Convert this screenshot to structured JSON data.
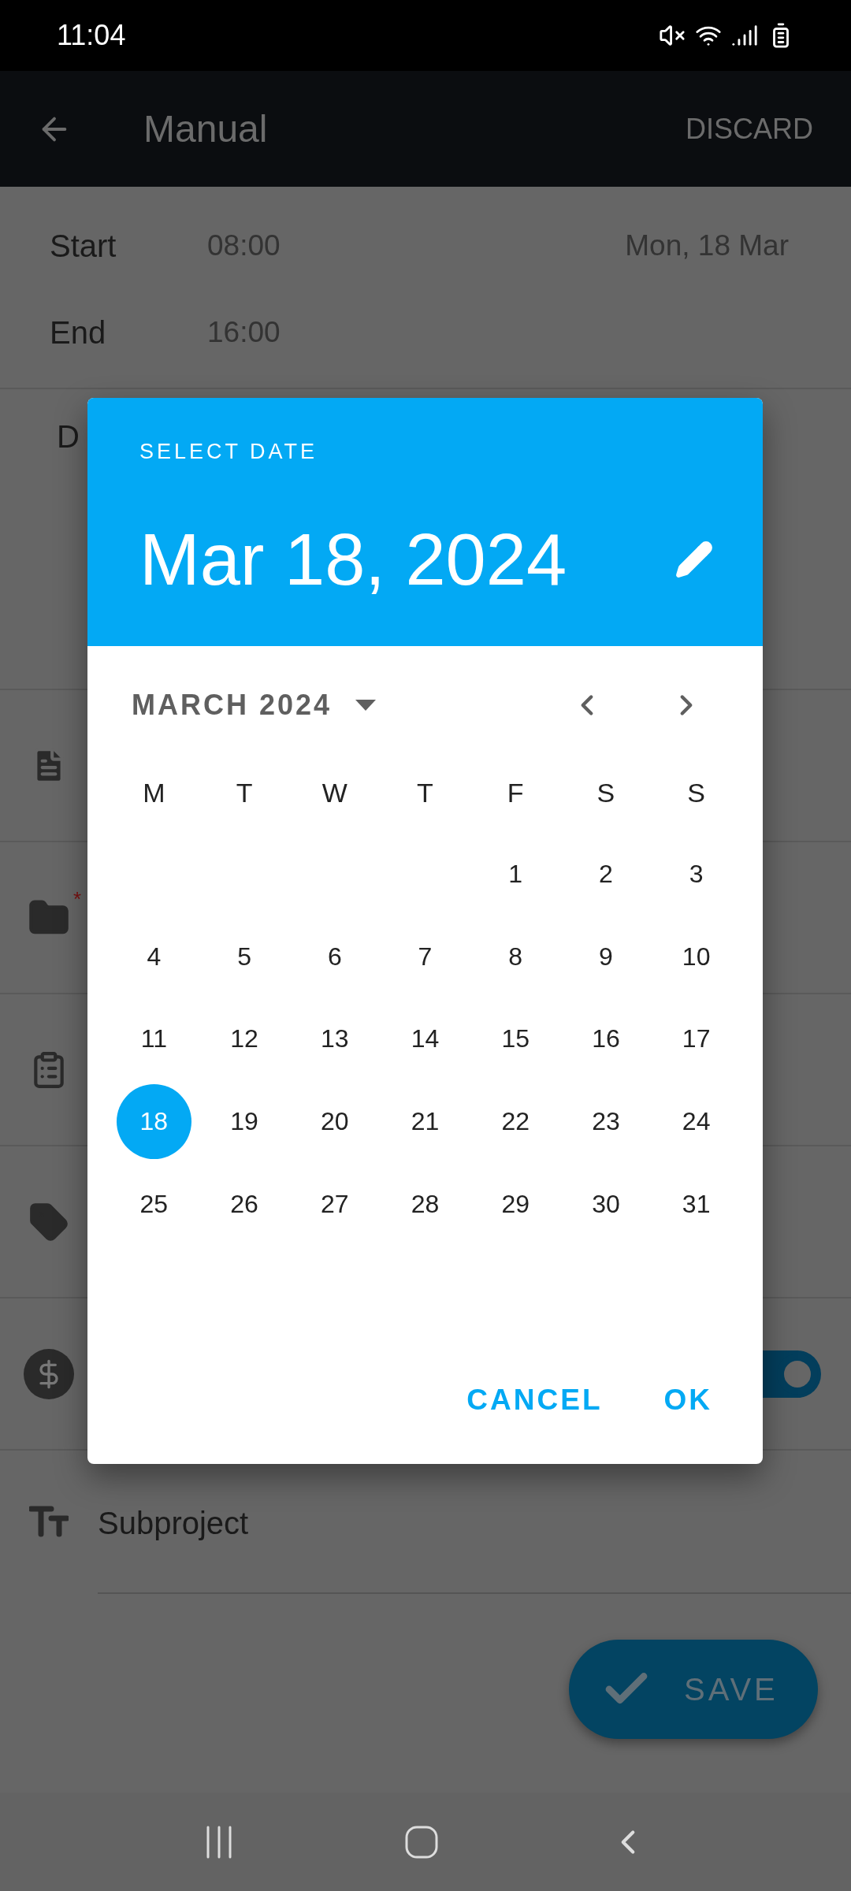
{
  "status_bar": {
    "time": "11:04"
  },
  "app_bar": {
    "title": "Manual",
    "action": "DISCARD"
  },
  "times": [
    {
      "label": "Start",
      "time": "08:00",
      "date": "Mon, 18 Mar"
    },
    {
      "label": "End",
      "time": "16:00"
    }
  ],
  "description_label": "D",
  "required_mark": "*",
  "billable_switch": {
    "on": true
  },
  "subproject": {
    "value": "Subproject"
  },
  "save_button": "SAVE",
  "dialog": {
    "heading": "SELECT DATE",
    "date": "Mar 18, 2024",
    "month": "MARCH 2024",
    "weekdays": [
      "M",
      "T",
      "W",
      "T",
      "F",
      "S",
      "S"
    ],
    "weeks": [
      [
        {
          "kind": "blank"
        },
        {
          "kind": "blank"
        },
        {
          "kind": "blank"
        },
        {
          "kind": "blank"
        },
        {
          "kind": "day",
          "day": "1",
          "selected": false
        },
        {
          "kind": "day",
          "day": "2",
          "selected": false
        },
        {
          "kind": "day",
          "day": "3",
          "selected": false
        }
      ],
      [
        {
          "day": "4",
          "selected": false
        },
        {
          "day": "5",
          "selected": false
        },
        {
          "day": "6",
          "selected": false
        },
        {
          "day": "7",
          "selected": false
        },
        {
          "day": "8",
          "selected": false
        },
        {
          "day": "9",
          "selected": false
        },
        {
          "day": "10",
          "selected": false
        }
      ],
      [
        {
          "day": "11",
          "selected": false
        },
        {
          "day": "12",
          "selected": false
        },
        {
          "day": "13",
          "selected": false
        },
        {
          "day": "14",
          "selected": false
        },
        {
          "day": "15",
          "selected": false
        },
        {
          "day": "16",
          "selected": false
        },
        {
          "day": "17",
          "selected": false
        }
      ],
      [
        {
          "day": "18",
          "selected": true
        },
        {
          "day": "19",
          "selected": false
        },
        {
          "day": "20",
          "selected": false
        },
        {
          "day": "21",
          "selected": false
        },
        {
          "day": "22",
          "selected": false
        },
        {
          "day": "23",
          "selected": false
        },
        {
          "day": "24",
          "selected": false
        }
      ],
      [
        {
          "day": "25",
          "selected": false
        },
        {
          "day": "26",
          "selected": false
        },
        {
          "day": "27",
          "selected": false
        },
        {
          "day": "28",
          "selected": false
        },
        {
          "day": "29",
          "selected": false
        },
        {
          "day": "30",
          "selected": false
        },
        {
          "day": "31",
          "selected": false
        }
      ]
    ],
    "buttons": [
      "CANCEL",
      "OK"
    ]
  }
}
